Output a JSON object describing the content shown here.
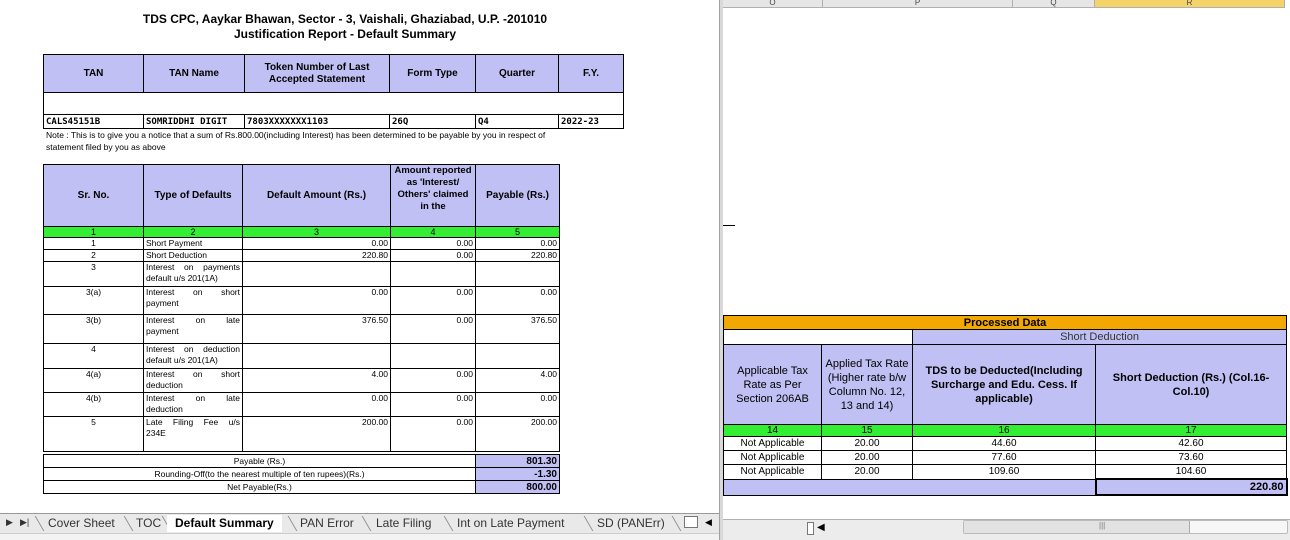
{
  "report": {
    "address_line": "TDS CPC, Aaykar Bhawan, Sector - 3, Vaishali, Ghaziabad, U.P. -201010",
    "title": "Justification Report - Default Summary",
    "header_cols": [
      "TAN",
      "TAN Name",
      "Token Number of Last Accepted Statement",
      "Form Type",
      "Quarter",
      "F.Y."
    ],
    "header_vals": [
      "CALS45151B",
      "SOMRIDDHI DIGIT",
      "7803XXXXXXX1103",
      "26Q",
      "Q4",
      "2022-23"
    ],
    "note": "Note : This is to give you a notice that a sum of Rs.800.00(including Interest) has been determined to be payable by you in respect of statement filed by you as above"
  },
  "defaults_table": {
    "cols": [
      "Sr. No.",
      "Type of Defaults",
      "Default Amount (Rs.)",
      "Amount reported as 'Interest/ Others' claimed in the",
      "Payable (Rs.)"
    ],
    "col_numbers": [
      "1",
      "2",
      "3",
      "4",
      "5"
    ],
    "rows": [
      {
        "sr": "1",
        "type": "Short Payment",
        "amount": "0.00",
        "reported": "0.00",
        "payable": "0.00"
      },
      {
        "sr": "2",
        "type": "Short Deduction",
        "amount": "220.80",
        "reported": "0.00",
        "payable": "220.80"
      },
      {
        "sr": "3",
        "type_a": "Interest on payments",
        "type_b": "default u/s 201(1A)",
        "amount": "",
        "reported": "",
        "payable": ""
      },
      {
        "sr": "3(a)",
        "type_a": "Interest on short",
        "type_b": "payment",
        "amount": "0.00",
        "reported": "0.00",
        "payable": "0.00"
      },
      {
        "sr": "3(b)",
        "type_a": "Interest on late",
        "type_b": "payment",
        "amount": "376.50",
        "reported": "0.00",
        "payable": "376.50"
      },
      {
        "sr": "4",
        "type_a": "Interest on deduction",
        "type_b": "default u/s 201(1A)",
        "amount": "",
        "reported": "",
        "payable": ""
      },
      {
        "sr": "4(a)",
        "type_a": "Interest on short",
        "type_b": "deduction",
        "amount": "4.00",
        "reported": "0.00",
        "payable": "4.00"
      },
      {
        "sr": "4(b)",
        "type_a": "Interest on late",
        "type_b": "deduction",
        "amount": "0.00",
        "reported": "0.00",
        "payable": "0.00"
      },
      {
        "sr": "5",
        "type_a": "Late Filing Fee u/s",
        "type_b": "234E",
        "amount": "200.00",
        "reported": "0.00",
        "payable": "200.00"
      }
    ],
    "payable_label": "Payable (Rs.)",
    "payable_value": "801.30",
    "rounding_label": "Rounding-Off(to the nearest multiple of ten rupees)(Rs.)",
    "rounding_value": "-1.30",
    "net_label": "Net Payable(Rs.)",
    "net_value": "800.00"
  },
  "tabs": [
    "Cover Sheet",
    "TOC",
    "Default Summary",
    "PAN Error",
    "Late Filing",
    "Int on Late Payment",
    "SD (PANErr)"
  ],
  "active_tab": "Default Summary",
  "right_sheet": {
    "col_letters": [
      "O",
      "P",
      "Q",
      "R"
    ],
    "processed_title": "Processed Data",
    "short_deduction_title": "Short Deduction",
    "cols": [
      "Applicable Tax Rate as Per Section 206AB",
      "Applied Tax Rate (Higher rate b/w Column No. 12, 13 and 14)",
      "TDS to be Deducted(Including Surcharge and Edu. Cess. If applicable)",
      "Short Deduction (Rs.) (Col.16-Col.10)"
    ],
    "col_numbers": [
      "14",
      "15",
      "16",
      "17"
    ],
    "rows": [
      [
        "Not Applicable",
        "20.00",
        "44.60",
        "42.60"
      ],
      [
        "Not Applicable",
        "20.00",
        "77.60",
        "73.60"
      ],
      [
        "Not Applicable",
        "20.00",
        "109.60",
        "104.60"
      ]
    ],
    "total": "220.80"
  },
  "colors": {
    "header_blue": "#c0c0f4",
    "number_green": "#33ee33",
    "processed_orange": "#f2a800"
  }
}
